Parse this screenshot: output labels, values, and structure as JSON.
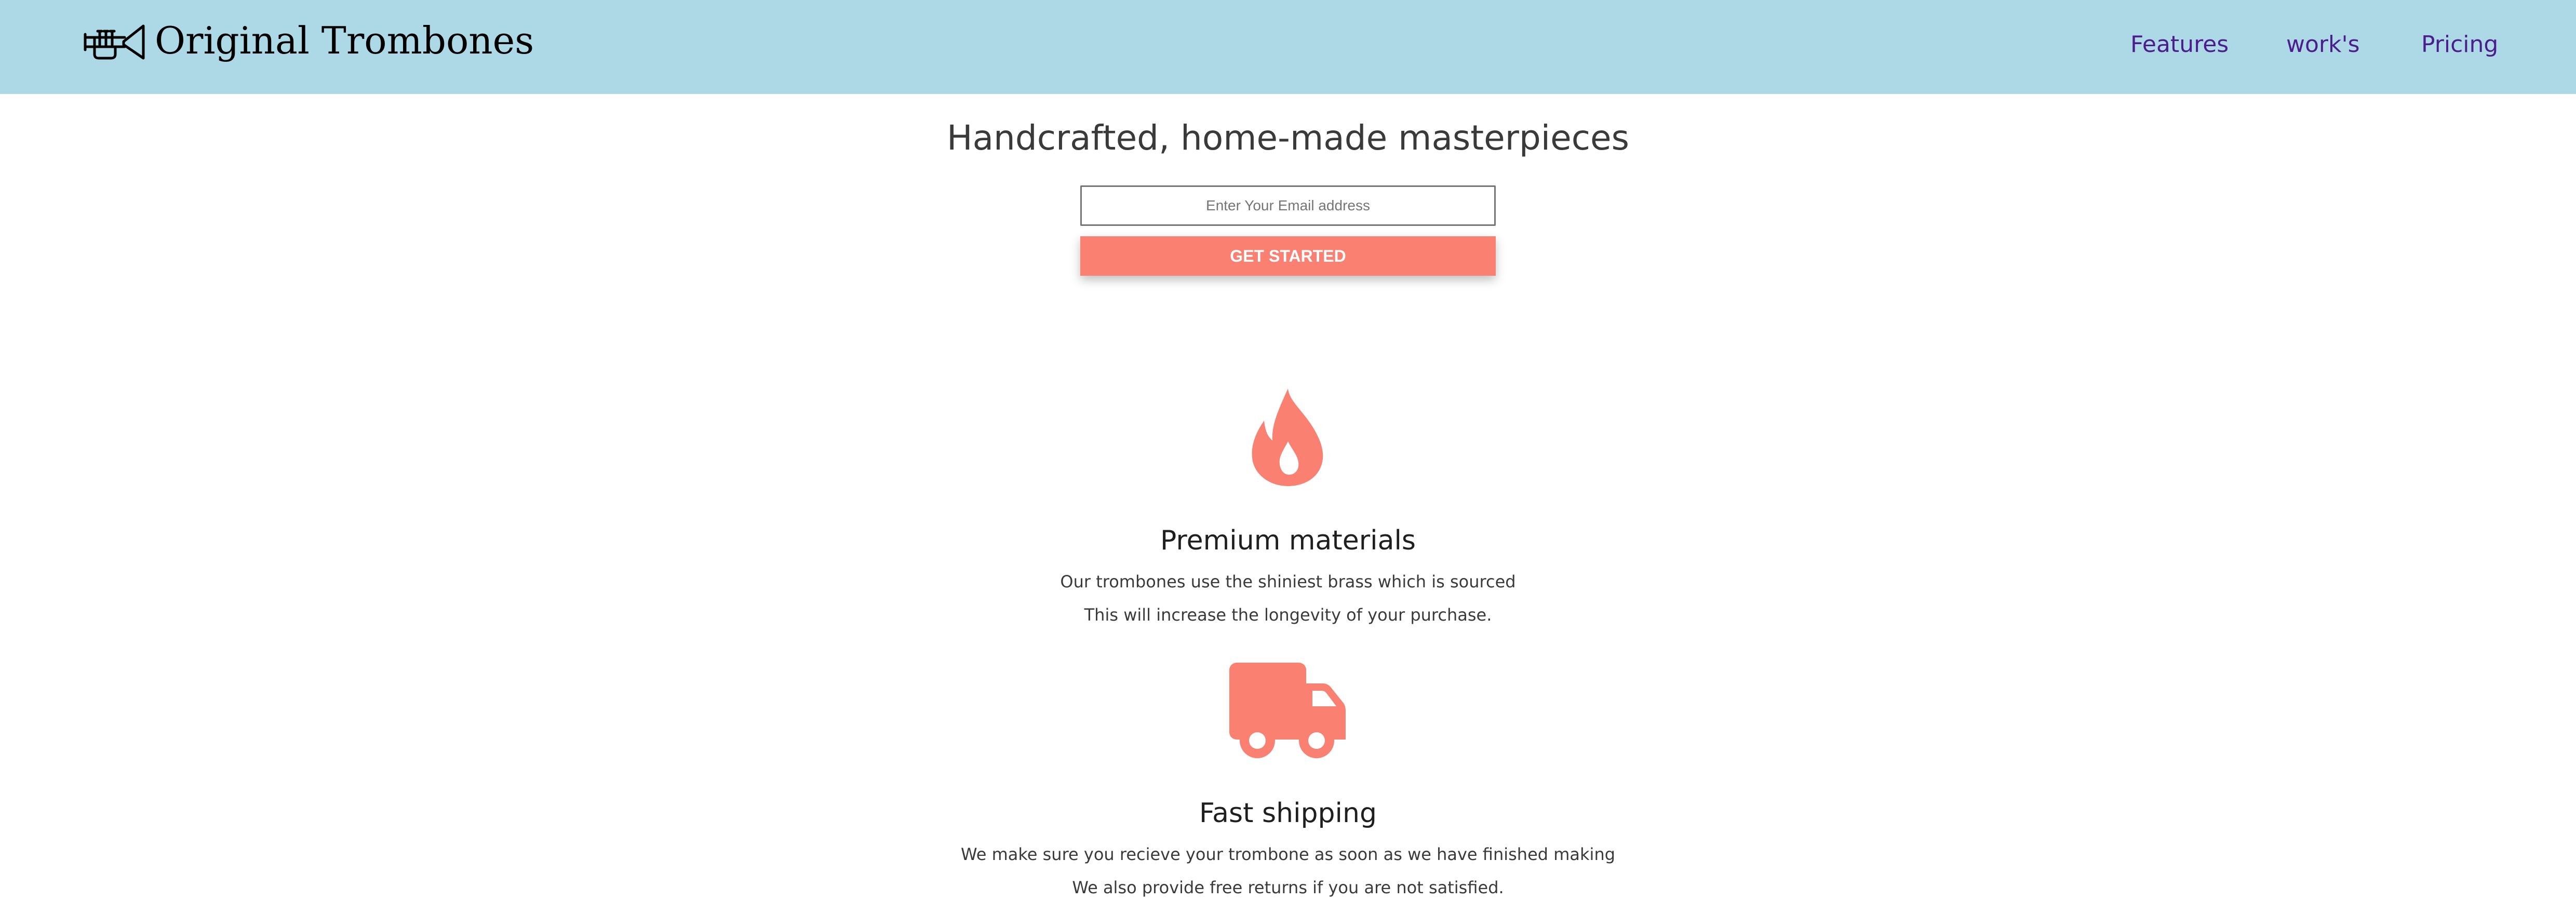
{
  "header": {
    "brand": "Original Trombones",
    "logo_icon": "trombone-icon",
    "background_color": "#add8e6",
    "nav": {
      "features": "Features",
      "works": "work's",
      "pricing": "Pricing"
    },
    "nav_color": "#4b1d8f"
  },
  "hero": {
    "title": "Handcrafted, home-made masterpieces",
    "email_placeholder": "Enter Your Email address",
    "email_value": "",
    "cta_label": "GET STARTED",
    "accent_color": "#fa8072"
  },
  "features": [
    {
      "icon": "flame-icon",
      "title": "Premium materials",
      "line1": "Our trombones use the shiniest brass which is sourced",
      "line2": "This will increase the longevity of your purchase."
    },
    {
      "icon": "truck-icon",
      "title": "Fast shipping",
      "line1": "We make sure you recieve your trombone as soon as we have finished making",
      "line2": "We also provide free returns if you are not satisfied."
    }
  ]
}
